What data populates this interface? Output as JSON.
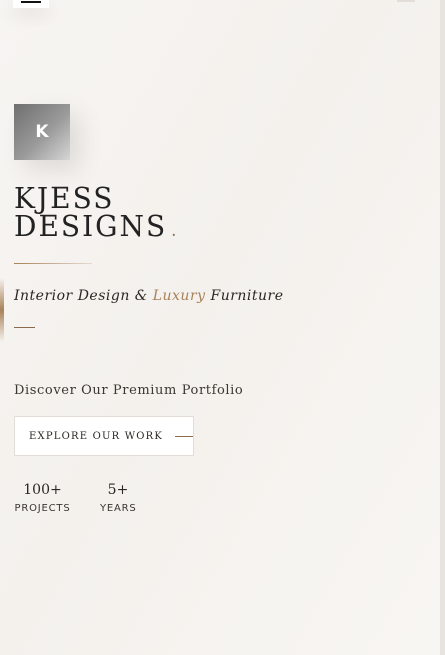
{
  "brand": {
    "logo_letter": "K",
    "title_line1": "KJESS",
    "title_line2": "DESIGNS",
    "title_dot": "."
  },
  "hero": {
    "subtitle_part1": "Interior Design & ",
    "subtitle_accent": "Luxury",
    "subtitle_part2": " Furniture",
    "discover": "Discover Our Premium Portfolio",
    "cta_label": "EXPLORE OUR WORK"
  },
  "stats": [
    {
      "value": "100+",
      "label": "PROJECTS"
    },
    {
      "value": "5+",
      "label": "YEARS"
    }
  ],
  "colors": {
    "accent": "#a98258",
    "text": "#1e1c1a",
    "background": "#f6f3ef"
  },
  "icons": {
    "menu": "hamburger-menu-icon",
    "cta_arrow": "line-arrow-icon"
  }
}
